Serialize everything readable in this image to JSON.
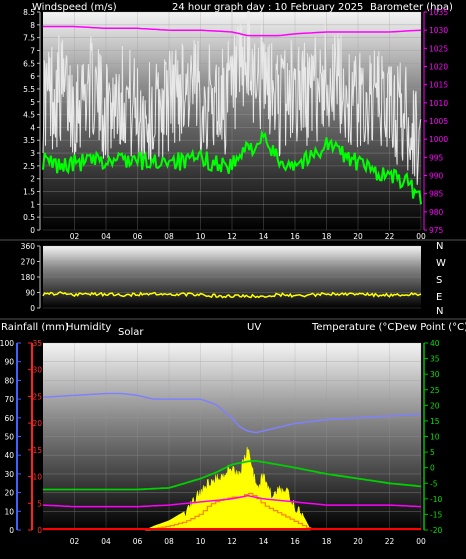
{
  "header": {
    "windspeed_label": "Windspeed (m/s)",
    "title": "24 hour graph day : 10 February 2025",
    "barometer_label": "Barometer (hpa)"
  },
  "wind_direction_labels": [
    "N",
    "W",
    "S",
    "E",
    "N"
  ],
  "bottom_labels": {
    "rainfall": "Rainfall (mm)",
    "humidity": "Humidity",
    "solar": "Solar",
    "uv": "UV",
    "temperature": "Temperature (°C)",
    "dew_point": "Dew Point (°C)"
  },
  "colors": {
    "wind_gust": "#e8e8e8",
    "wind_avg": "#00ff00",
    "barometer": "#ff00ff",
    "direction": "#ffff00",
    "humidity": "#8080ff",
    "temperature": "#00d000",
    "dew_point": "#ff00ff",
    "solar": "#ffff00",
    "uv": "#ff8000",
    "rain": "#ff0000"
  },
  "chart_data": [
    {
      "type": "line",
      "title": "24 hour graph day : 10 February 2025",
      "xlabel": "",
      "ylabel": "Windspeed (m/s)",
      "y2label": "Barometer (hpa)",
      "x_ticks": [
        "02",
        "04",
        "06",
        "08",
        "10",
        "12",
        "14",
        "16",
        "18",
        "20",
        "22",
        "00"
      ],
      "ylim": [
        0,
        8.5
      ],
      "yticks": [
        "0",
        "0.5",
        "1",
        "1.5",
        "2",
        "2.5",
        "3",
        "3.5",
        "4",
        "4.5",
        "5",
        "5.5",
        "6",
        "6.5",
        "7",
        "7.5",
        "8",
        "8.5"
      ],
      "y2lim": [
        975,
        1035
      ],
      "y2ticks": [
        "975",
        "980",
        "985",
        "990",
        "995",
        "1000",
        "1005",
        "1010",
        "1015",
        "1020",
        "1025",
        "1030",
        "1035"
      ],
      "grid": true,
      "series": [
        {
          "axis": "left",
          "x": [
            0,
            1,
            2,
            3,
            4,
            5,
            6,
            7,
            8,
            9,
            10,
            11,
            12,
            13,
            14,
            15,
            16,
            17,
            18,
            19,
            20,
            21,
            22,
            23,
            24
          ],
          "values": [
            5.2,
            5.5,
            5.0,
            5.8,
            4.8,
            5.6,
            4.6,
            4.5,
            5.4,
            5.8,
            5.2,
            5.0,
            5.2,
            6.4,
            6.0,
            5.0,
            5.6,
            5.3,
            6.2,
            5.6,
            5.0,
            5.3,
            4.8,
            4.5,
            3.5
          ],
          "low": [
            3.0,
            3.2,
            2.8,
            3.6,
            2.6,
            3.2,
            2.4,
            2.2,
            3.0,
            3.6,
            3.0,
            2.8,
            3.0,
            3.8,
            3.6,
            2.8,
            3.2,
            3.0,
            3.8,
            3.2,
            2.8,
            3.0,
            2.6,
            2.2,
            1.4
          ],
          "high": [
            7.2,
            7.8,
            7.0,
            7.6,
            6.6,
            7.4,
            6.8,
            6.6,
            7.2,
            7.6,
            7.4,
            7.2,
            7.6,
            8.6,
            8.0,
            7.2,
            7.8,
            7.4,
            8.2,
            7.6,
            7.0,
            7.2,
            6.8,
            6.6,
            5.0
          ]
        },
        {
          "axis": "left",
          "x": [
            0,
            1,
            2,
            3,
            4,
            5,
            6,
            7,
            8,
            9,
            10,
            11,
            12,
            13,
            14,
            15,
            16,
            17,
            18,
            19,
            20,
            21,
            22,
            23,
            24
          ],
          "values": [
            2.7,
            2.5,
            2.6,
            2.7,
            2.6,
            2.8,
            2.7,
            2.6,
            2.8,
            2.6,
            2.8,
            2.6,
            2.5,
            3.2,
            3.5,
            2.7,
            2.6,
            2.8,
            3.4,
            3.0,
            2.6,
            2.3,
            2.1,
            1.9,
            1.2
          ]
        },
        {
          "axis": "right",
          "x": [
            0,
            2,
            4,
            6,
            8,
            10,
            12,
            13,
            14,
            15,
            16,
            18,
            20,
            22,
            24
          ],
          "values": [
            1031,
            1031,
            1030.5,
            1030.5,
            1030,
            1030,
            1029.5,
            1028.5,
            1028.5,
            1028.5,
            1029,
            1029.5,
            1029.5,
            1029.5,
            1030
          ]
        }
      ]
    },
    {
      "type": "line",
      "ylabel": "",
      "ylim": [
        0,
        360
      ],
      "yticks": [
        "0",
        "90",
        "180",
        "270",
        "360"
      ],
      "grid": true,
      "series": [
        {
          "x": [
            0,
            1,
            2,
            3,
            4,
            5,
            6,
            7,
            8,
            9,
            10,
            11,
            12,
            13,
            14,
            15,
            16,
            17,
            18,
            19,
            20,
            21,
            22,
            23,
            24
          ],
          "values": [
            80,
            85,
            78,
            82,
            80,
            75,
            80,
            82,
            78,
            80,
            76,
            70,
            66,
            70,
            68,
            78,
            72,
            76,
            80,
            78,
            80,
            76,
            74,
            78,
            80
          ]
        }
      ]
    },
    {
      "type": "area",
      "ylim": [
        0,
        100
      ],
      "yticks": [
        "0",
        "10",
        "20",
        "30",
        "40",
        "50",
        "60",
        "70",
        "80",
        "90",
        "100"
      ],
      "rain_ylim": [
        0,
        35
      ],
      "rain_yticks": [
        "0",
        "5",
        "10",
        "15",
        "20",
        "25",
        "30",
        "35"
      ],
      "y2lim": [
        -20,
        40
      ],
      "y2ticks": [
        "-20",
        "-15",
        "-10",
        "-5",
        "0",
        "5",
        "10",
        "15",
        "20",
        "25",
        "30",
        "35",
        "40"
      ],
      "grid": true,
      "series": [
        {
          "axis": "left",
          "x": [
            0,
            2,
            4,
            5,
            6,
            7,
            8,
            10,
            11,
            12,
            12.5,
            13,
            13.5,
            14,
            15,
            16,
            18,
            20,
            22,
            24
          ],
          "values": [
            71,
            72,
            73,
            73,
            72,
            70,
            70,
            70,
            67,
            60,
            55,
            53,
            52,
            53,
            55,
            57,
            59,
            60,
            61,
            62
          ]
        },
        {
          "axis": "right",
          "x": [
            0,
            2,
            4,
            6,
            8,
            10,
            11,
            12,
            13,
            13.5,
            14,
            16,
            18,
            20,
            22,
            24
          ],
          "values": [
            -7,
            -7,
            -7,
            -7,
            -6.5,
            -3.5,
            -1.5,
            1,
            2,
            2.2,
            1.8,
            0,
            -2,
            -3.5,
            -5,
            -6
          ]
        },
        {
          "axis": "right",
          "x": [
            0,
            2,
            4,
            6,
            8,
            10,
            12,
            13,
            14,
            16,
            18,
            20,
            22,
            24
          ],
          "values": [
            -12,
            -12.5,
            -12.5,
            -12.5,
            -12,
            -11,
            -10,
            -9,
            -10,
            -11,
            -12,
            -12,
            -12,
            -12.5
          ]
        },
        {
          "axis": "solar",
          "x": [
            6.5,
            7,
            8,
            9,
            10,
            10.5,
            11,
            11.5,
            12,
            12.5,
            13,
            13.3,
            13.6,
            14,
            14.5,
            15,
            15.5,
            16,
            16.5,
            17
          ],
          "values": [
            0,
            2,
            5,
            10,
            20,
            25,
            28,
            30,
            34,
            30,
            44,
            32,
            22,
            30,
            18,
            22,
            20,
            12,
            8,
            0
          ]
        },
        {
          "axis": "uv",
          "x": [
            6.5,
            8,
            9,
            10,
            10.5,
            11,
            12,
            12.5,
            13,
            13.5,
            14,
            15,
            16,
            17
          ],
          "values": [
            0,
            1,
            2,
            4,
            6,
            7,
            8,
            8,
            9,
            8,
            6,
            4,
            2,
            0
          ]
        },
        {
          "axis": "rain",
          "x": [
            0,
            24
          ],
          "values": [
            0,
            0
          ]
        }
      ]
    }
  ]
}
